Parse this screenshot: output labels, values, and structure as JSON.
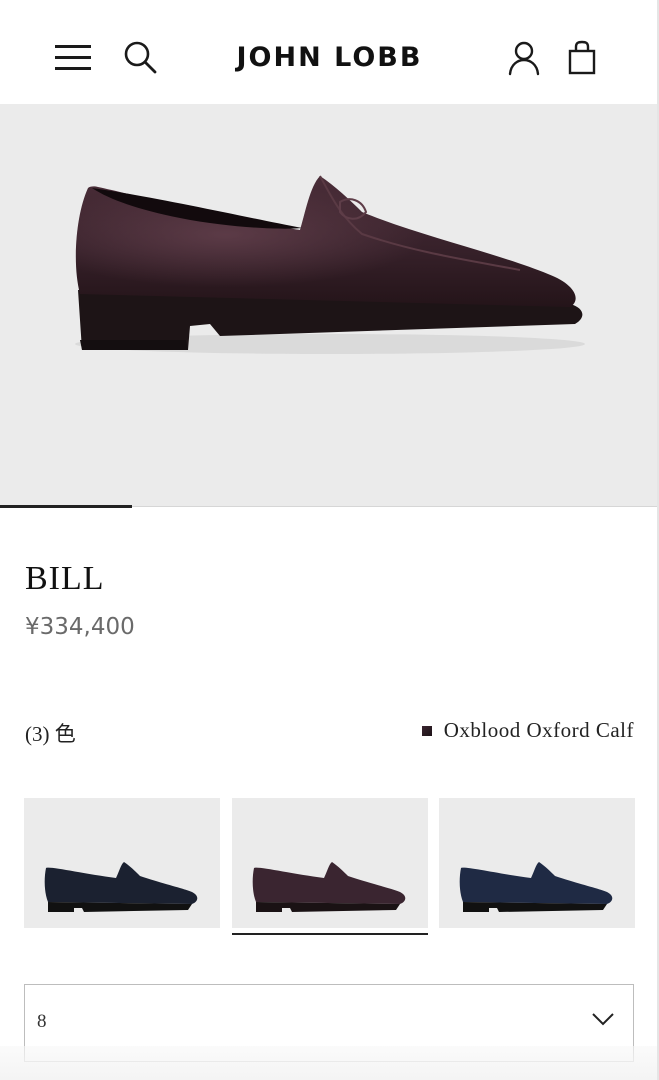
{
  "header": {
    "brand": "JOHN LOBB",
    "icons": {
      "menu": "menu-icon",
      "search": "search-icon",
      "account": "user-icon",
      "bag": "shopping-bag-icon"
    }
  },
  "hero": {
    "image": "oxblood-penny-loafer-side-view",
    "background": "#ebebeb",
    "carousel_progress": 0.2
  },
  "product": {
    "name": "BILL",
    "price": "¥334,400"
  },
  "colors": {
    "count_label": "(3) 色",
    "selected_name": "Oxblood Oxford Calf",
    "options": [
      {
        "shoe": "navy-loafer",
        "leather": "#1b2130"
      },
      {
        "shoe": "oxblood-loafer",
        "leather": "#3a2530",
        "selected": true
      },
      {
        "shoe": "navy-loafer",
        "leather": "#1f2a44"
      }
    ]
  },
  "size": {
    "value": "8"
  },
  "colors_theme": {
    "text": "#111111",
    "muted": "#6a6a6a",
    "panel": "#ebebeb",
    "border": "#bdbdbd"
  }
}
